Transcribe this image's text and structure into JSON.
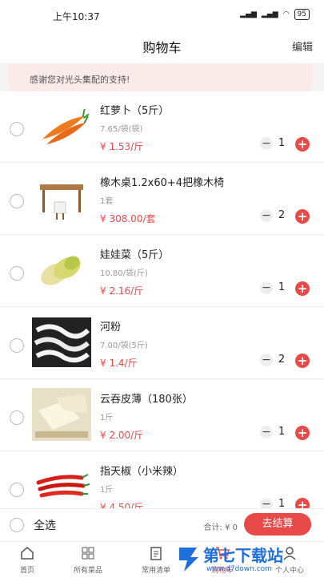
{
  "status": {
    "time": "上午10:37",
    "battery": "95"
  },
  "header": {
    "title": "购物车",
    "edit_label": "编辑"
  },
  "notice": {
    "text": "感谢您对光头集配的支持!"
  },
  "items": [
    {
      "name": "红萝卜（5斤）",
      "spec": "7.65/袋(袋)",
      "price": "¥ 1.53/斤",
      "qty": "1"
    },
    {
      "name": "橡木桌1.2x60+4把橡木椅",
      "spec": "1套",
      "price": "¥ 308.00/套",
      "qty": "2"
    },
    {
      "name": "娃娃菜（5斤）",
      "spec": "10.80/袋(斤)",
      "price": "¥ 2.16/斤",
      "qty": "1"
    },
    {
      "name": "河粉",
      "spec": "7.00/袋(5斤)",
      "price": "¥ 1.4/斤",
      "qty": "2"
    },
    {
      "name": "云吞皮薄（180张）",
      "spec": "1斤",
      "price": "¥ 2.00/斤",
      "qty": "1"
    },
    {
      "name": "指天椒（小米辣）",
      "spec": "1斤",
      "price": "¥ 4.50/斤",
      "qty": "1"
    }
  ],
  "controls": {
    "minus": "−",
    "plus": "+"
  },
  "bottom": {
    "select_all": "全选",
    "total": "合计: ¥ 0",
    "checkout": "去结算"
  },
  "tabs": [
    {
      "label": "首页",
      "icon": "home-icon"
    },
    {
      "label": "所有菜品",
      "icon": "grid-icon"
    },
    {
      "label": "常用清单",
      "icon": "clipboard-icon"
    },
    {
      "label": "购物车",
      "icon": "cart-icon"
    },
    {
      "label": "个人中心",
      "icon": "user-icon"
    }
  ],
  "watermark": {
    "text": "第七下载站",
    "url": "www.d7down.com"
  },
  "colors": {
    "accent": "#e84a4a",
    "notice_bg": "#fbeaea",
    "watermark": "#1e6fd9"
  }
}
